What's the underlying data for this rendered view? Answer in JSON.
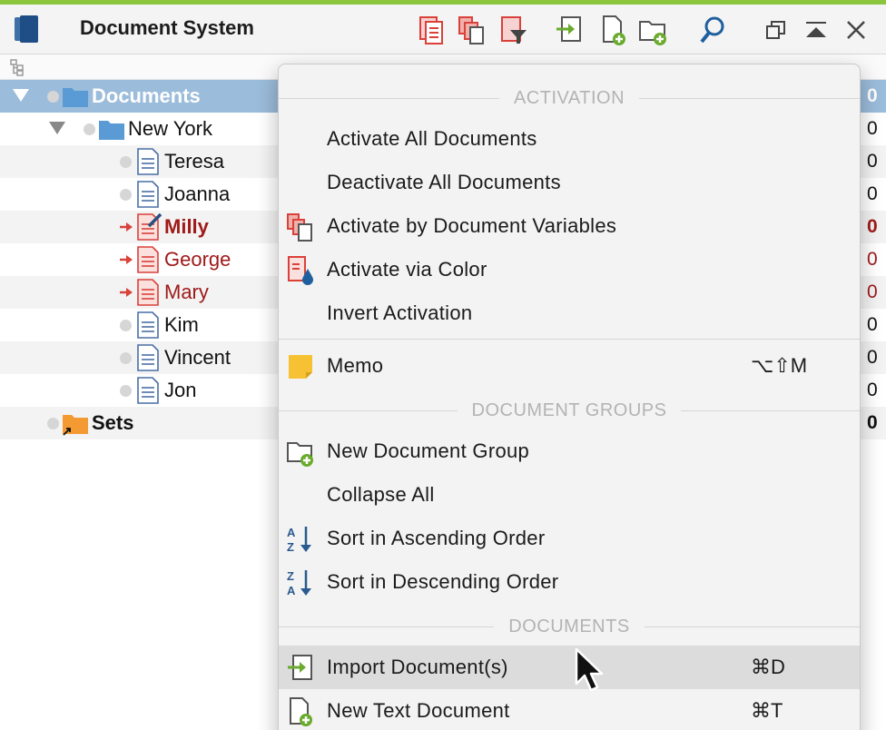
{
  "window": {
    "title": "Document System"
  },
  "toolbar": {
    "buttons": [
      {
        "icon": "activate-documents-icon"
      },
      {
        "icon": "document-variables-icon"
      },
      {
        "icon": "filter-documents-icon"
      },
      {
        "icon": "import-icon"
      },
      {
        "icon": "new-document-icon"
      },
      {
        "icon": "new-folder-icon"
      },
      {
        "icon": "search-icon"
      },
      {
        "icon": "undock-icon"
      },
      {
        "icon": "collapse-icon"
      },
      {
        "icon": "close-icon"
      }
    ]
  },
  "tree": {
    "root": {
      "label": "Documents",
      "count": "0"
    },
    "group": {
      "label": "New York",
      "count": "0"
    },
    "documents": [
      {
        "label": "Teresa",
        "count": "0",
        "activated": false
      },
      {
        "label": "Joanna",
        "count": "0",
        "activated": false
      },
      {
        "label": "Milly",
        "count": "0",
        "activated": true,
        "current": true
      },
      {
        "label": "George",
        "count": "0",
        "activated": true
      },
      {
        "label": "Mary",
        "count": "0",
        "activated": true
      },
      {
        "label": "Kim",
        "count": "0",
        "activated": false
      },
      {
        "label": "Vincent",
        "count": "0",
        "activated": false
      },
      {
        "label": "Jon",
        "count": "0",
        "activated": false
      }
    ],
    "sets": {
      "label": "Sets",
      "count": "0"
    }
  },
  "menu": {
    "sections": {
      "activation": "ACTIVATION",
      "document_groups": "DOCUMENT GROUPS",
      "documents": "DOCUMENTS"
    },
    "items": {
      "activate_all": "Activate All Documents",
      "deactivate_all": "Deactivate All Documents",
      "activate_by_variables": "Activate by Document Variables",
      "activate_via_color": "Activate via Color",
      "invert_activation": "Invert Activation",
      "memo": "Memo",
      "memo_shortcut": "⌥⇧M",
      "new_group": "New Document Group",
      "collapse_all": "Collapse All",
      "sort_asc": "Sort in Ascending Order",
      "sort_desc": "Sort in Descending Order",
      "import": "Import Document(s)",
      "import_shortcut": "⌘D",
      "new_text": "New Text Document",
      "new_text_shortcut": "⌘T"
    }
  },
  "colors": {
    "accent_strip": "#8cc63f",
    "selection": "#9bbcdb",
    "activated_text": "#a01a1a",
    "folder_blue": "#5b9bd5",
    "sets_orange": "#f39a32"
  }
}
